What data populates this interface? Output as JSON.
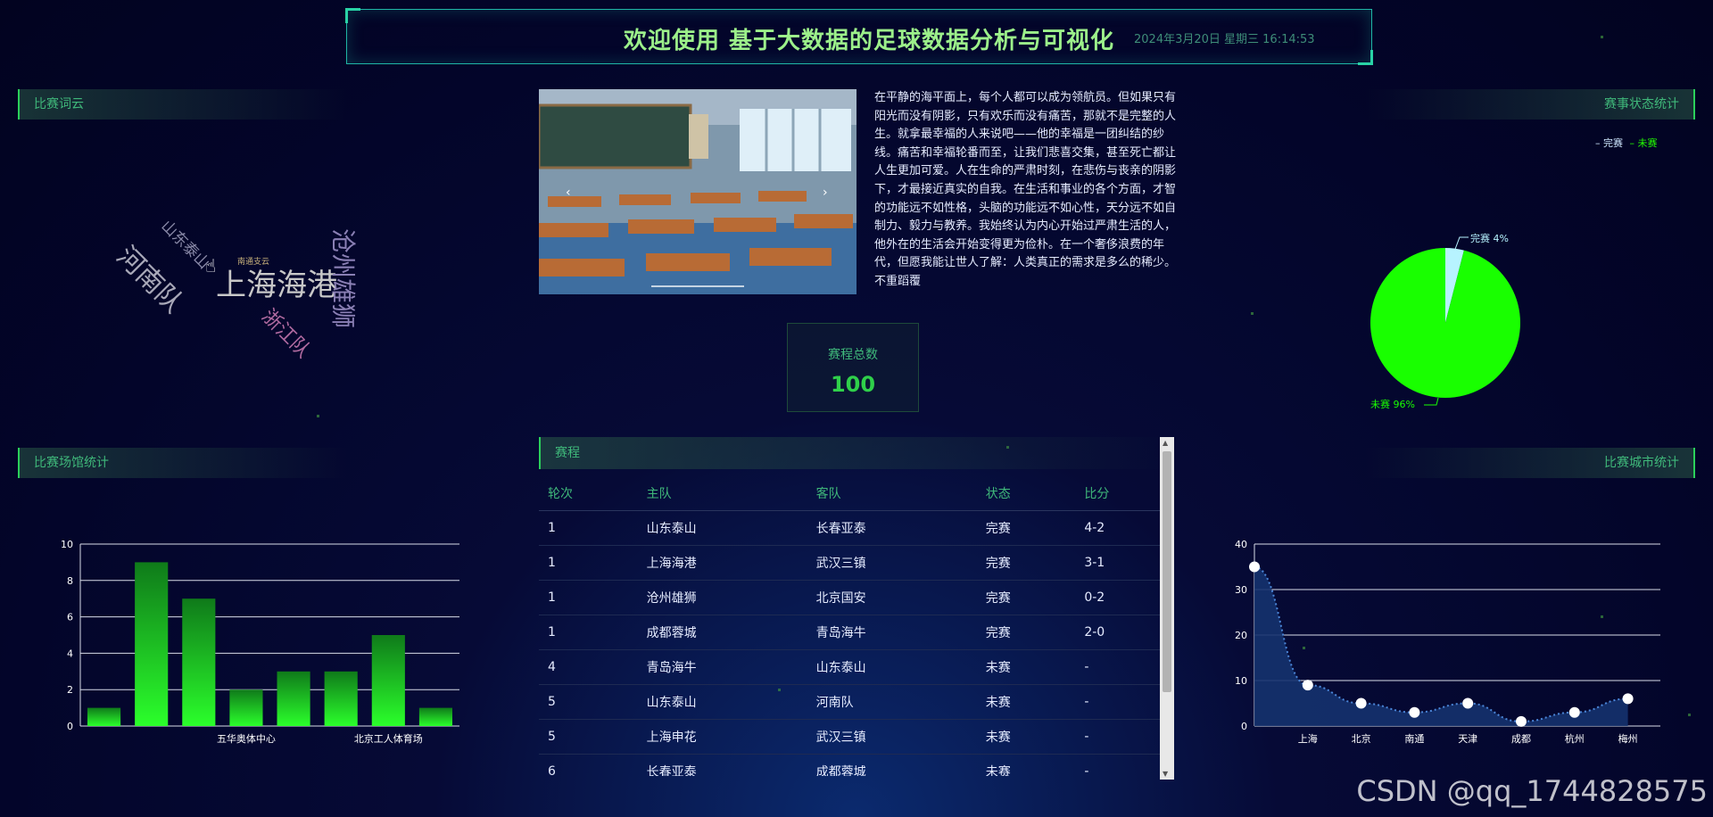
{
  "header": {
    "title": "欢迎使用 基于大数据的足球数据分析与可视化",
    "datetime": "2024年3月20日 星期三 16:14:53"
  },
  "panels": {
    "word_cloud": "比赛词云",
    "status_stats": "赛事状态统计",
    "venue_stats": "比赛场馆统计",
    "city_stats": "比赛城市统计"
  },
  "word_cloud": [
    {
      "text": "上海海港",
      "color": "#c8c8c8"
    },
    {
      "text": "河南队",
      "color": "#a8a8b8"
    },
    {
      "text": "沧州雄狮",
      "color": "#8a7fb4"
    },
    {
      "text": "山东泰山",
      "color": "#8a8aa8"
    },
    {
      "text": "浙江队",
      "color": "#b06aa0"
    },
    {
      "text": "南通支云",
      "color": "#c7b07a"
    }
  ],
  "intro_text": "在平静的海平面上，每个人都可以成为领航员。但如果只有阳光而没有阴影，只有欢乐而没有痛苦，那就不是完整的人生。就拿最幸福的人来说吧——他的幸福是一团纠结的纱线。痛苦和幸福轮番而至，让我们悲喜交集，甚至死亡都让人生更加可爱。人在生命的严肃时刻，在悲伤与丧亲的阴影下，才最接近真实的自我。在生活和事业的各个方面，才智的功能远不如性格，头脑的功能远不如心性，天分远不如自制力、毅力与教养。我始终认为内心开始过严肃生活的人，他外在的生活会开始变得更为俭朴。在一个奢侈浪费的年代，但愿我能让世人了解：人类真正的需求是多么的稀少。不重蹈覆",
  "total": {
    "label": "赛程总数",
    "value": "100"
  },
  "schedule": {
    "title": "赛程",
    "columns": [
      "轮次",
      "主队",
      "客队",
      "状态",
      "比分"
    ],
    "rows": [
      [
        "1",
        "山东泰山",
        "长春亚泰",
        "完赛",
        "4-2"
      ],
      [
        "1",
        "上海海港",
        "武汉三镇",
        "完赛",
        "3-1"
      ],
      [
        "1",
        "沧州雄狮",
        "北京国安",
        "完赛",
        "0-2"
      ],
      [
        "1",
        "成都蓉城",
        "青岛海牛",
        "完赛",
        "2-0"
      ],
      [
        "4",
        "青岛海牛",
        "山东泰山",
        "未赛",
        "-"
      ],
      [
        "5",
        "山东泰山",
        "河南队",
        "未赛",
        "-"
      ],
      [
        "5",
        "上海申花",
        "武汉三镇",
        "未赛",
        "-"
      ],
      [
        "6",
        "长春亚泰",
        "成都蓉城",
        "未赛",
        "-"
      ]
    ]
  },
  "legend": [
    {
      "label": "完赛",
      "color": "#cfe8ff"
    },
    {
      "label": "未赛",
      "color": "#22ff00"
    }
  ],
  "watermark": "CSDN @qq_1744828575",
  "chart_data": [
    {
      "type": "pie",
      "title": "",
      "labels": [
        "完赛",
        "未赛"
      ],
      "values": [
        4,
        96
      ],
      "slice_labels": [
        "完赛 4%",
        "未赛 96%"
      ],
      "colors": [
        "#b7f3ff",
        "#19ff00"
      ]
    },
    {
      "type": "bar",
      "title": "",
      "categories": [
        "",
        "",
        "",
        "五华奥体中心",
        "",
        "",
        "北京工人体育场",
        ""
      ],
      "values": [
        1,
        9,
        7,
        2,
        3,
        3,
        5,
        1
      ],
      "ylim": [
        0,
        10
      ],
      "yticks": [
        "0",
        "2",
        "4",
        "6",
        "8",
        "10"
      ],
      "grid": true,
      "color": "#22ff22"
    },
    {
      "type": "area",
      "title": "",
      "categories": [
        "",
        "上海",
        "北京",
        "南通",
        "天津",
        "成都",
        "杭州",
        "梅州"
      ],
      "values": [
        35,
        9,
        5,
        3,
        5,
        1,
        3,
        6
      ],
      "ylim": [
        0,
        40
      ],
      "yticks": [
        "0",
        "10",
        "20",
        "30",
        "40"
      ],
      "grid": true,
      "color": "#1f4f9a"
    }
  ]
}
